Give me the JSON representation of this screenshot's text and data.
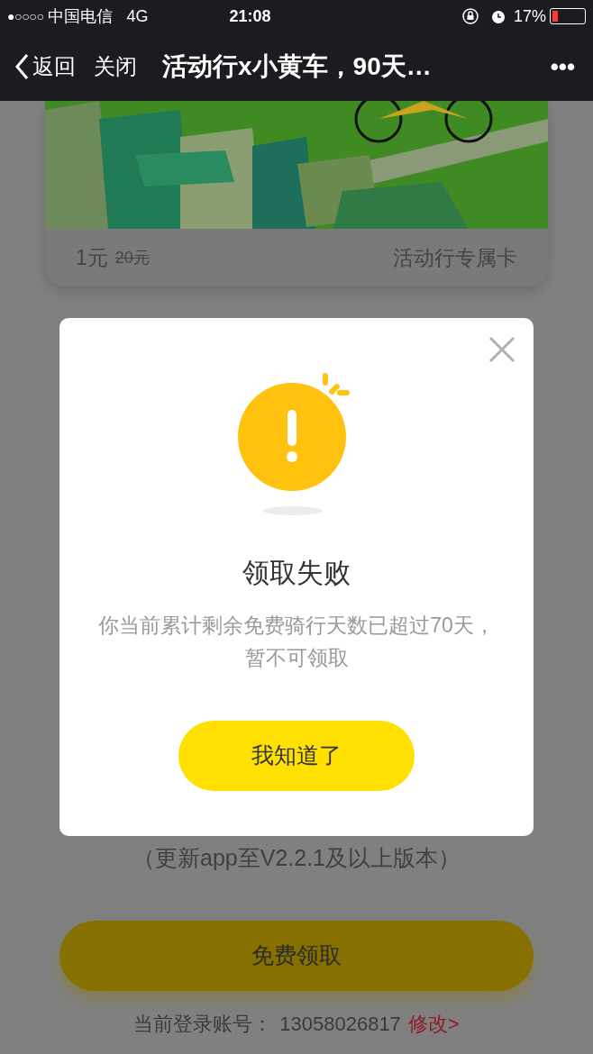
{
  "status_bar": {
    "signal": "●○○○○",
    "carrier": "中国电信",
    "network": "4G",
    "time": "21:08",
    "battery": "17%"
  },
  "nav": {
    "back": "返回",
    "close": "关闭",
    "title": "活动行x小黄车，90天…",
    "more": "•••"
  },
  "card": {
    "price": "1元",
    "original_price": "20元",
    "label": "活动行专属卡"
  },
  "version_note": "（更新app至V2.2.1及以上版本）",
  "claim_button": "免费领取",
  "account": {
    "label": "当前登录账号：",
    "number": "13058026817",
    "edit_link": "修改>"
  },
  "dialog": {
    "title": "领取失败",
    "message": "你当前累计剩余免费骑行天数已超过70天，暂不可领取",
    "button": "我知道了"
  }
}
